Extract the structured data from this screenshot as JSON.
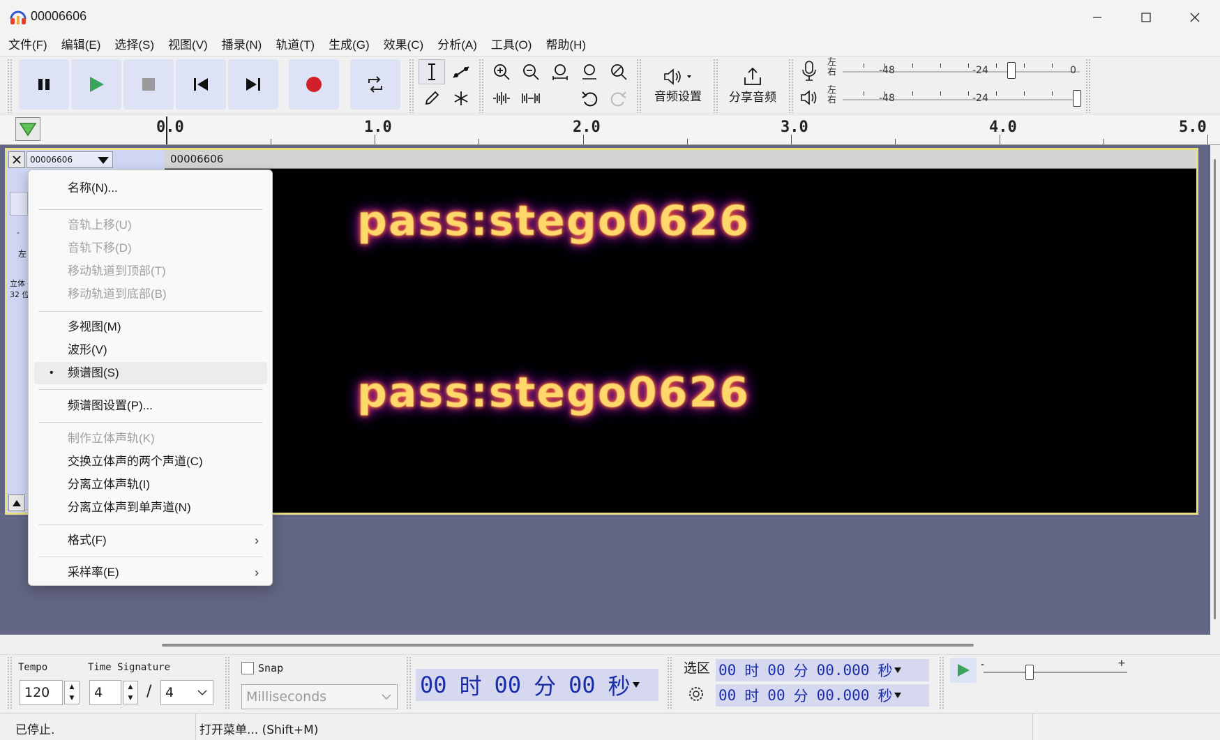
{
  "window": {
    "title": "00006606",
    "app_icon": "headphones-icon"
  },
  "menubar": [
    "文件(F)",
    "编辑(E)",
    "选择(S)",
    "视图(V)",
    "播录(N)",
    "轨道(T)",
    "生成(G)",
    "效果(C)",
    "分析(A)",
    "工具(O)",
    "帮助(H)"
  ],
  "toolbar": {
    "audio_setup_label": "音频设置",
    "share_audio_label": "分享音频",
    "meter_record": {
      "labels": [
        "-48",
        "-24",
        "0"
      ],
      "channels": [
        "左",
        "右"
      ]
    },
    "meter_play": {
      "labels": [
        "-48",
        "-24"
      ],
      "channels": [
        "左",
        "右"
      ]
    },
    "colors": {
      "play": "#3aa35c",
      "record": "#d0202a",
      "transport_bg": "#dde3f4"
    }
  },
  "ruler": {
    "labels": [
      "0.0",
      "1.0",
      "2.0",
      "3.0",
      "4.0",
      "5.0"
    ]
  },
  "track": {
    "name": "00006606",
    "clip_name": "00006606",
    "info_line1": "立体",
    "info_line2": "32 位",
    "gain_label": "左",
    "spectrogram_text": [
      "pass:stego0626",
      "pass:stego0626"
    ]
  },
  "context_menu": {
    "items": [
      {
        "label": "名称(N)...",
        "disabled": false
      },
      {
        "label": "音轨上移(U)",
        "disabled": true
      },
      {
        "label": "音轨下移(D)",
        "disabled": true
      },
      {
        "label": "移动轨道到顶部(T)",
        "disabled": true
      },
      {
        "label": "移动轨道到底部(B)",
        "disabled": true
      },
      {
        "label": "多视图(M)",
        "disabled": false
      },
      {
        "label": "波形(V)",
        "disabled": false
      },
      {
        "label": "频谱图(S)",
        "disabled": false,
        "checked": true
      },
      {
        "label": "频谱图设置(P)...",
        "disabled": false
      },
      {
        "label": "制作立体声轨(K)",
        "disabled": true
      },
      {
        "label": "交换立体声的两个声道(C)",
        "disabled": false
      },
      {
        "label": "分离立体声轨(I)",
        "disabled": false
      },
      {
        "label": "分离立体声到单声道(N)",
        "disabled": false
      },
      {
        "label": "格式(F)",
        "disabled": false,
        "submenu": true
      },
      {
        "label": "采样率(E)",
        "disabled": false,
        "submenu": true
      }
    ]
  },
  "bottom": {
    "tempo_label": "Tempo",
    "tempo_value": "120",
    "time_signature_label": "Time Signature",
    "ts_numerator": "4",
    "ts_slash": "/",
    "ts_denominator": "4",
    "snap_label": "Snap",
    "snap_unit": "Milliseconds",
    "time_big": {
      "h": "00",
      "h_unit": "时",
      "m": "00",
      "m_unit": "分",
      "s": "00",
      "s_unit": "秒"
    },
    "selection_label": "选区",
    "sel_start": {
      "h": "00",
      "h_unit": "时",
      "m": "00",
      "m_unit": "分",
      "s": "00.000",
      "s_unit": "秒"
    },
    "sel_end": {
      "h": "00",
      "h_unit": "时",
      "m": "00",
      "m_unit": "分",
      "s": "00.000",
      "s_unit": "秒"
    },
    "speed_min": "-",
    "speed_max": "+"
  },
  "status": {
    "state": "已停止.",
    "hint": "打开菜单... (Shift+M)"
  }
}
